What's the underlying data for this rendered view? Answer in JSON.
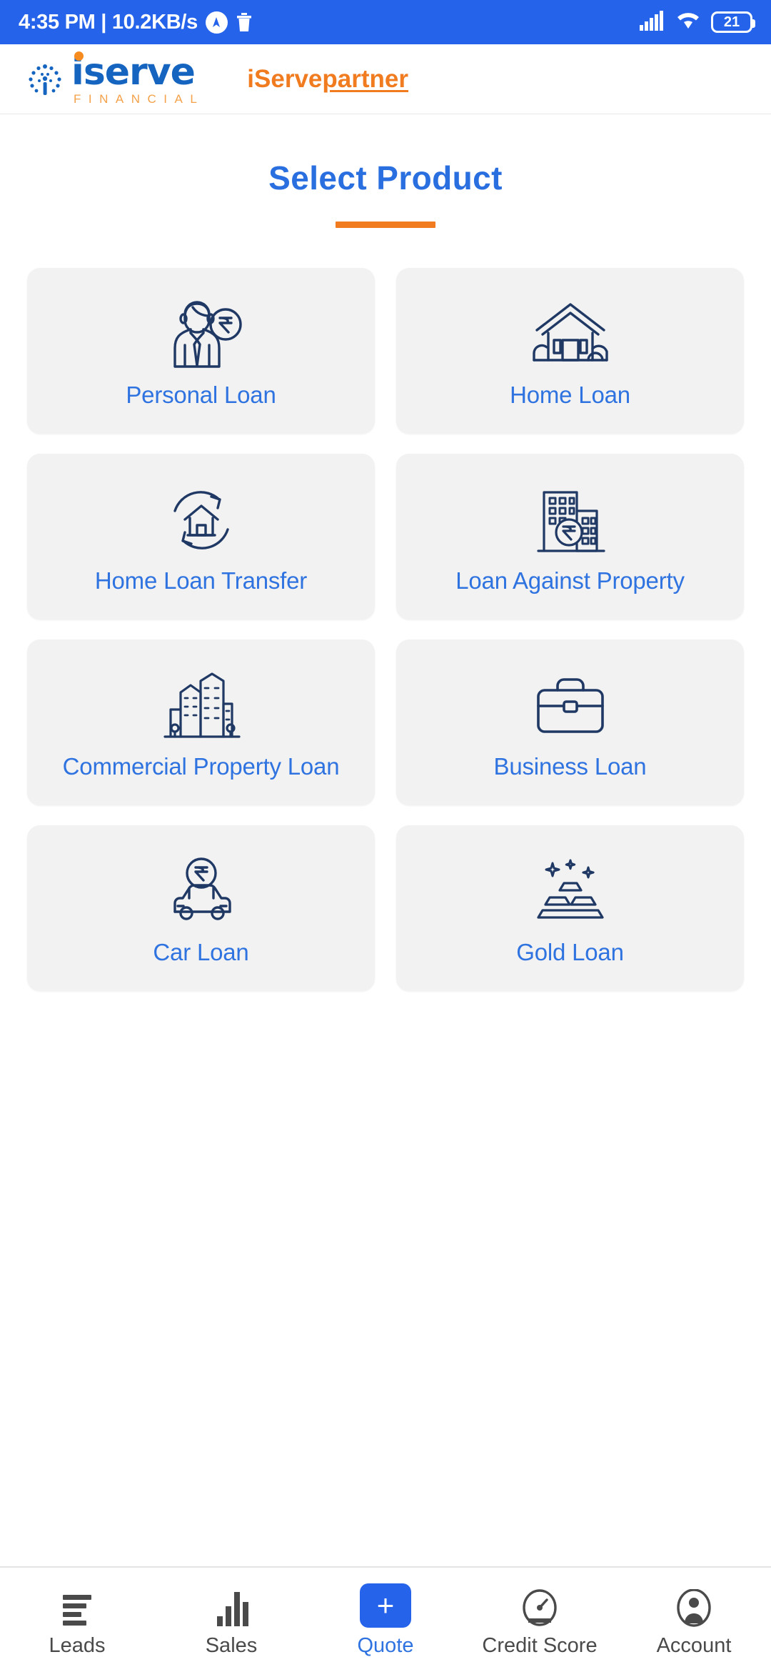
{
  "status_bar": {
    "time_and_speed": "4:35 PM | 10.2KB/s",
    "vpn_icon": "vpn-icon",
    "trash_icon": "trash-icon",
    "signal_icon": "signal-icon",
    "wifi_icon": "wifi-icon",
    "battery_level": "21",
    "background_color": "#2563EB"
  },
  "header": {
    "logo_main": "iserve",
    "logo_sub": "FINANCIAL",
    "logo_emblem": "iserve-circular-emblem-icon",
    "partner_prefix": "iServe",
    "partner_suffix": "partner",
    "brand_blue": "#1565C0",
    "brand_orange": "#F07C1F"
  },
  "title": {
    "text": "Select Product",
    "color": "#2A6FE0",
    "underline_color": "#F07C1F"
  },
  "products": [
    {
      "label": "Personal Loan",
      "icon": "person-with-rupee-coin-icon"
    },
    {
      "label": "Home Loan",
      "icon": "house-with-bushes-icon"
    },
    {
      "label": "Home Loan Transfer",
      "icon": "house-with-refresh-arrows-icon"
    },
    {
      "label": "Loan Against Property",
      "icon": "building-with-rupee-icon"
    },
    {
      "label": "Commercial Property Loan",
      "icon": "city-buildings-icon"
    },
    {
      "label": "Business Loan",
      "icon": "briefcase-icon"
    },
    {
      "label": "Car Loan",
      "icon": "car-with-rupee-icon"
    },
    {
      "label": "Gold Loan",
      "icon": "gold-bars-icon"
    }
  ],
  "bottom_nav": {
    "items": [
      {
        "label": "Leads",
        "icon": "list-lines-icon",
        "active": false
      },
      {
        "label": "Sales",
        "icon": "bar-chart-icon",
        "active": false
      },
      {
        "label": "Quote",
        "icon": "plus-icon",
        "active": true
      },
      {
        "label": "Credit Score",
        "icon": "speedometer-icon",
        "active": false
      },
      {
        "label": "Account",
        "icon": "user-avatar-icon",
        "active": false
      }
    ],
    "active_color": "#2563EB"
  }
}
